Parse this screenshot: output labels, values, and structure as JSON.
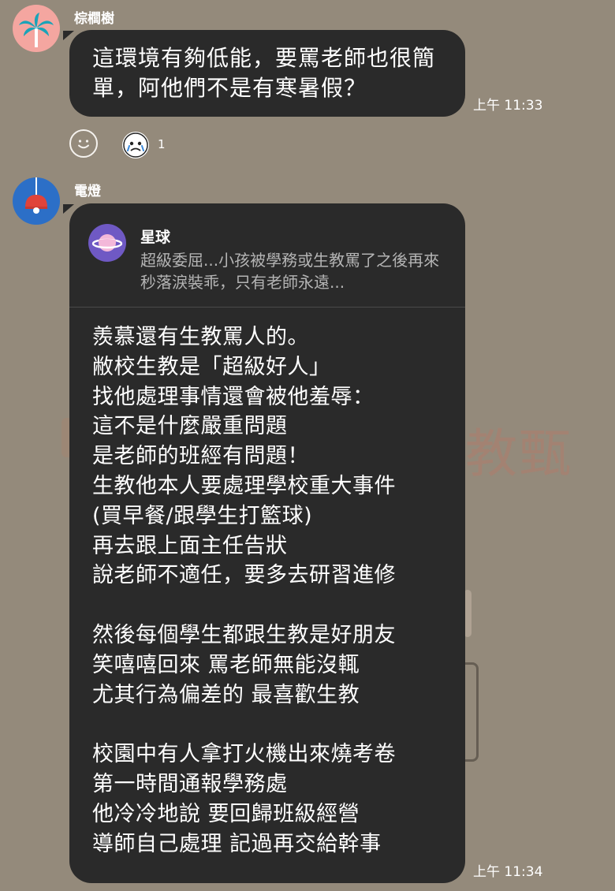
{
  "background": {
    "watermark_text": "教甄"
  },
  "messages": [
    {
      "sender": "棕櫚樹",
      "avatar_icon": "palm-tree-icon",
      "text": "這環境有夠低能，要罵老師也很簡單，阿他們不是有寒暑假？",
      "time": "上午 11:33",
      "reaction_icon": "smiley-add-reaction-icon",
      "reaction_count": "1"
    },
    {
      "sender": "電燈",
      "avatar_icon": "pendant-lamp-icon",
      "reply": {
        "name": "星球",
        "icon": "planet-icon",
        "snippet": "超級委屈...小孩被學務或生教罵了之後再來秒落淚裝乖，只有老師永遠..."
      },
      "lines": [
        "羨慕還有生教罵人的。",
        "敝校生教是「超級好人」",
        "找他處理事情還會被他羞辱：",
        "這不是什麼嚴重問題",
        "是老師的班經有問題！",
        "生教他本人要處理學校重大事件",
        "(買早餐/跟學生打籃球)",
        "再去跟上面主任告狀",
        "說老師不適任，要多去研習進修",
        "",
        "然後每個學生都跟生教是好朋友",
        "笑嘻嘻回來 罵老師無能沒輒",
        "尤其行為偏差的 最喜歡生教",
        "",
        "校園中有人拿打火機出來燒考卷",
        "第一時間通報學務處",
        "他冷冷地說 要回歸班級經營",
        "導師自己處理 記過再交給幹事"
      ],
      "time": "上午 11:34"
    }
  ]
}
